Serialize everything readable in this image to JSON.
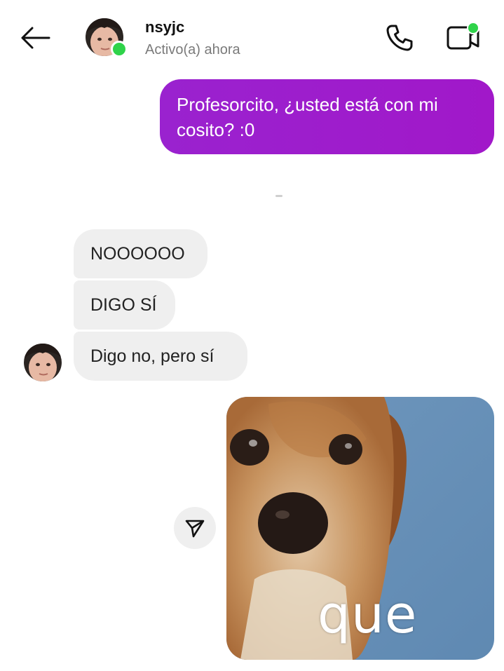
{
  "header": {
    "username": "nsyjc",
    "status": "Activo(a) ahora",
    "back_icon": "arrow-left-icon",
    "call_icon": "phone-icon",
    "video_icon": "video-camera-icon",
    "online_color": "#2fd34a"
  },
  "messages": {
    "sent_1": "Profesorcito, ¿usted está con mi cosito? :0",
    "received": [
      {
        "text": "NOOOOOO"
      },
      {
        "text": "DIGO SÍ"
      },
      {
        "text": "Digo no, pero sí"
      }
    ],
    "image_caption": "que"
  },
  "colors": {
    "sent_bubble": "#9a22cf",
    "received_bubble": "#efefef",
    "status_text": "#7a7a7a"
  },
  "share_icon": "paper-plane-icon"
}
